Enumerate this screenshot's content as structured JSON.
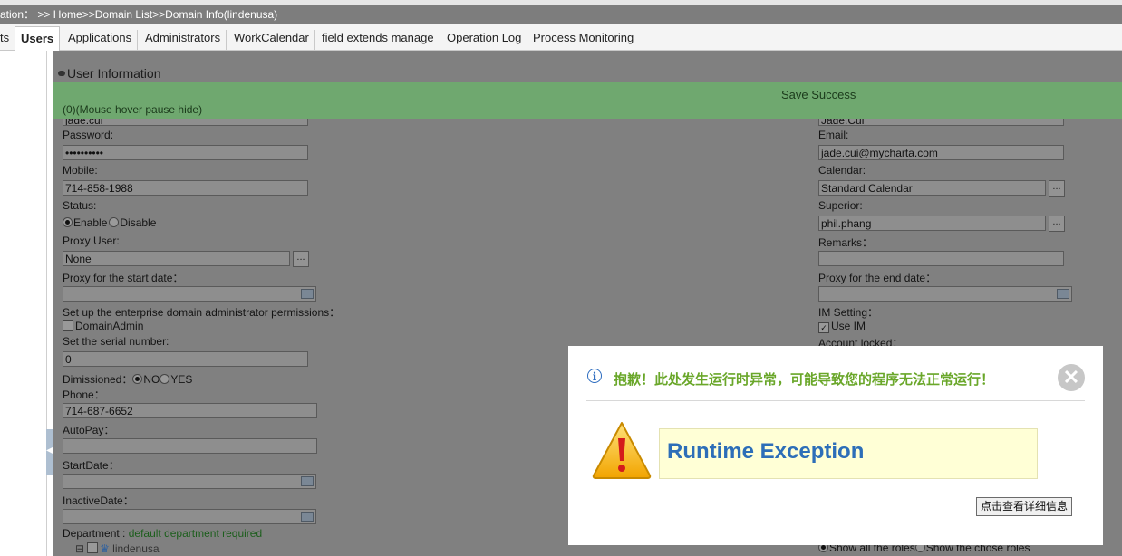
{
  "breadcrumb": "ation： >> Home>>Domain List>>Domain Info(lindenusa)",
  "tabs": [
    {
      "label": "ts"
    },
    {
      "label": "Users",
      "active": true
    },
    {
      "label": "Applications"
    },
    {
      "label": "Administrators"
    },
    {
      "label": "WorkCalendar"
    },
    {
      "label": "field extends manage"
    },
    {
      "label": "Operation Log"
    },
    {
      "label": "Process Monitoring"
    }
  ],
  "section": {
    "title": "User Information"
  },
  "toast": {
    "message": "Save Success",
    "hint": "(0)(Mouse hover pause hide)"
  },
  "form": {
    "left": {
      "login_value": "jade.cui",
      "password_label": "Password:",
      "password_value": "••••••••••",
      "mobile_label": "Mobile:",
      "mobile_value": "714-858-1988",
      "status_label": "Status:",
      "status_enable": "Enable",
      "status_disable": "Disable",
      "proxy_user_label": "Proxy User:",
      "proxy_user_value": "None",
      "proxy_start_label": "Proxy for the start date：",
      "domain_admin_perm_label": "Set up the enterprise domain administrator permissions：",
      "domain_admin_checkbox": "DomainAdmin",
      "serial_label": "Set the serial number:",
      "serial_value": "0",
      "dimissioned_label": "Dimissioned：",
      "dimissioned_no": "NO",
      "dimissioned_yes": "YES",
      "phone_label": "Phone：",
      "phone_value": "714-687-6652",
      "autopay_label": "AutoPay：",
      "startdate_label": "StartDate：",
      "inactivedate_label": "InactiveDate：",
      "department_label": "Department :",
      "department_note": "default department required",
      "tree_node": "lindenusa"
    },
    "right": {
      "name_value": "Jade.Cui",
      "email_label": "Email:",
      "email_value": "jade.cui@mycharta.com",
      "calendar_label": "Calendar:",
      "calendar_value": "Standard Calendar",
      "superior_label": "Superior:",
      "superior_value": "phil.phang",
      "remarks_label": "Remarks：",
      "proxy_end_label": "Proxy for the end date：",
      "im_label": "IM Setting：",
      "im_checkbox": "Use IM",
      "account_locked_label": "Account locked：",
      "roles_all": "Show all the roles",
      "roles_chosen": "Show the chose roles"
    }
  },
  "dialog": {
    "title": "抱歉！此处发生运行时异常，可能导致您的程序无法正常运行！",
    "message": "Runtime Exception",
    "detail_button": "点击查看详细信息",
    "close_glyph": "✕",
    "info_glyph": "i"
  },
  "colors": {
    "toast": "#6fa86f",
    "dialog_title": "#6aa72a",
    "exception_text": "#2d6eb8",
    "overlay": "#808080"
  }
}
